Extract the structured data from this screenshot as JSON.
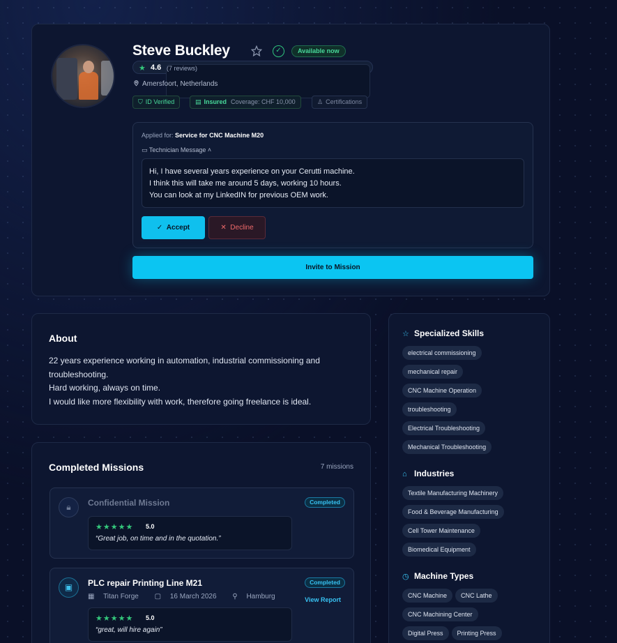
{
  "profile": {
    "name": "Steve Buckley",
    "availability": "Available now",
    "rating": "4.6",
    "reviews": "(7 reviews)",
    "location": "Amersfoort, Netherlands",
    "chips": {
      "id_verified": "ID Verified",
      "insured": "Insured",
      "coverage": "Coverage: CHF 10,000",
      "certifications": "Certifications"
    },
    "applied_label": "Applied for:",
    "applied_for": "Service for CNC Machine M20",
    "technician_message_label": "Technician Message",
    "message_lines": [
      "Hi, I have several years experience on your Cerutti machine.",
      "I think this will take me around 5 days, working 10 hours.",
      "You can look at my LinkedIN for previous OEM work."
    ],
    "accept_label": "Accept",
    "decline_label": "Decline",
    "invite_label": "Invite to Mission"
  },
  "about": {
    "title": "About",
    "lines": [
      "22 years experience working in automation, industrial commissioning and troubleshooting.",
      "Hard working, always on time.",
      "I would like more flexibility with work, therefore going freelance is ideal."
    ]
  },
  "missions": {
    "title": "Completed Missions",
    "count": "7 missions",
    "items": [
      {
        "title": "Confidential Mission",
        "status": "Completed",
        "rating": "5.0",
        "quote": "“Great job, on time and in the quotation.”",
        "icon": "lock-icon"
      },
      {
        "title": "PLC repair Printing Line M21",
        "status": "Completed",
        "company": "Titan Forge",
        "date": "16 March 2026",
        "city": "Hamburg",
        "view_report": "View Report",
        "rating": "5.0",
        "quote": "“great, will hire again”",
        "icon": "briefcase-icon"
      }
    ]
  },
  "skills": {
    "specialized_title": "Specialized Skills",
    "specialized": [
      "electrical commissioning",
      "mechanical repair",
      "CNC Machine Operation",
      "troubleshooting",
      "Electrical Troubleshooting",
      "Mechanical Troubleshooting"
    ],
    "industries_title": "Industries",
    "industries": [
      "Textile Manufacturing Machinery",
      "Food & Beverage Manufacturing",
      "Cell Tower Maintenance",
      "Biomedical Equipment"
    ],
    "machine_title": "Machine Types",
    "machines": [
      "CNC Machine",
      "CNC Lathe",
      "CNC Machining Center",
      "Digital Press",
      "Printing Press"
    ]
  },
  "colors": {
    "accent": "#0bc5f2",
    "success": "#34c77b",
    "danger": "#ef6a6a",
    "background": "#0a1028"
  }
}
